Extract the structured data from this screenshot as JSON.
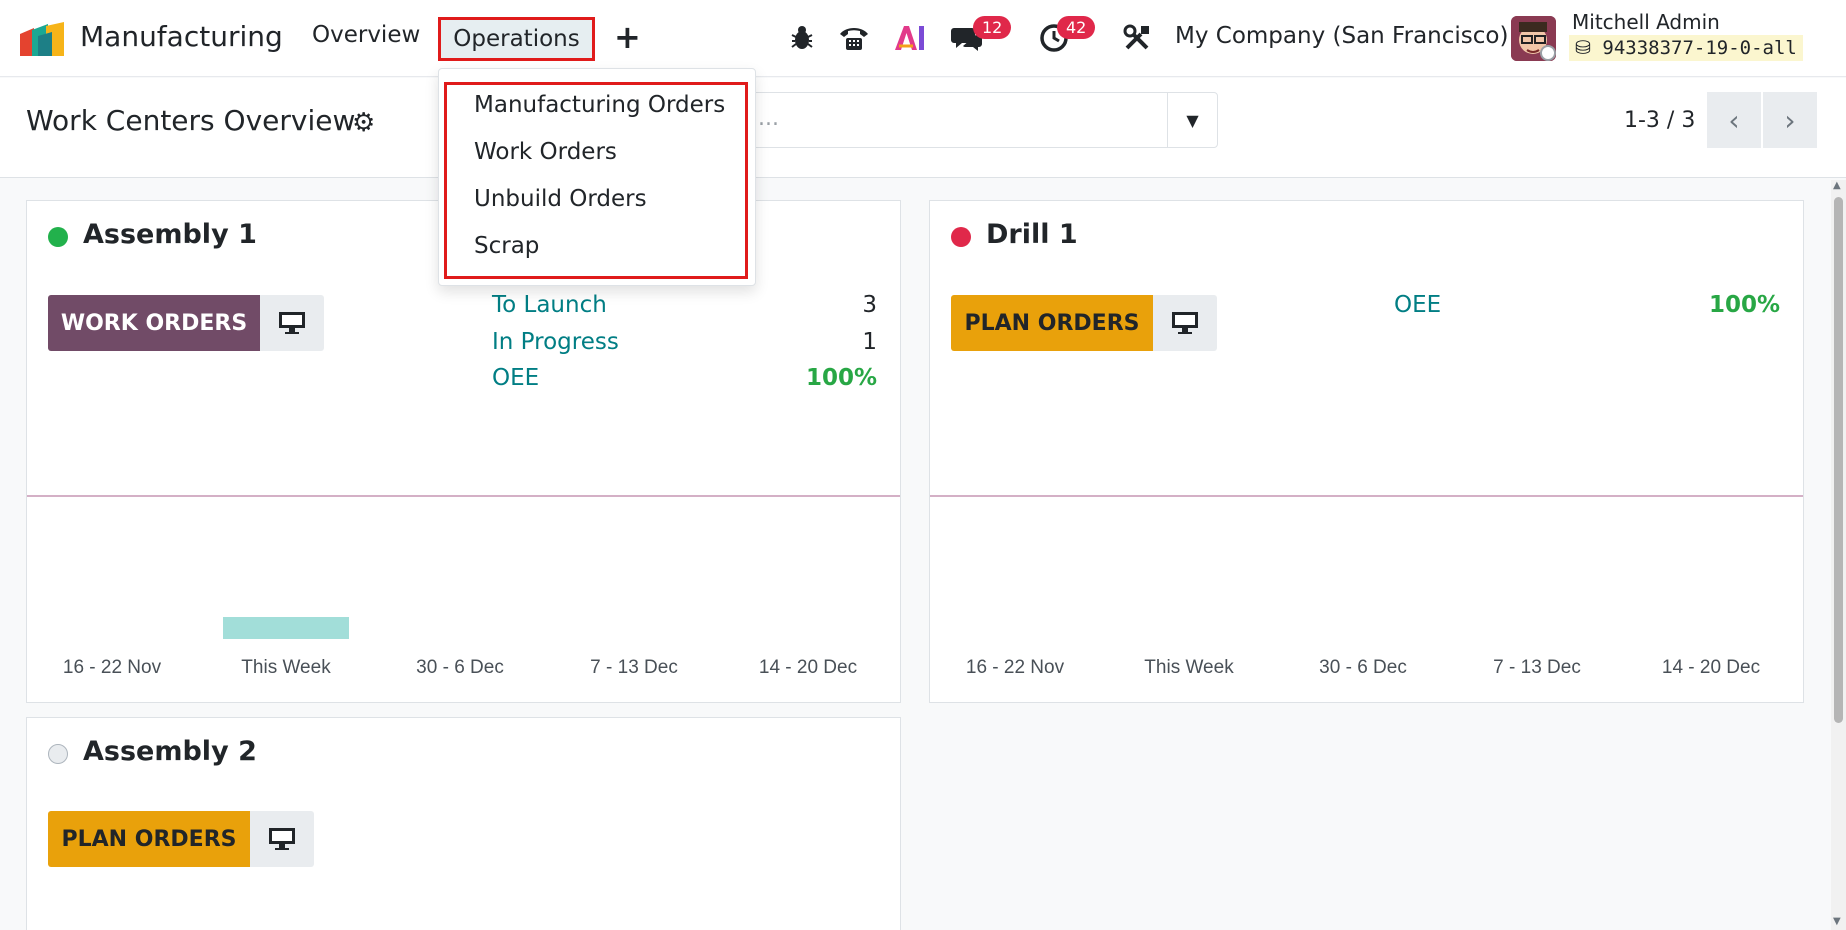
{
  "navbar": {
    "app_name": "Manufacturing",
    "menu": [
      "Overview",
      "Operations"
    ],
    "plus": "+",
    "chat_badge": "12",
    "activity_badge": "42",
    "company": "My Company (San Francisco)",
    "user_name": "Mitchell Admin",
    "database": "94338377-19-0-all"
  },
  "control": {
    "title": "Work Centers Overview",
    "search_placeholder": "...",
    "pager": "1-3 / 3"
  },
  "dropdown": {
    "items": [
      "Manufacturing Orders",
      "Work Orders",
      "Unbuild Orders",
      "Scrap"
    ]
  },
  "cards": [
    {
      "name": "Assembly 1",
      "status_color": "#22b14c",
      "button": "WORK ORDERS",
      "stats": [
        {
          "label": "To Launch",
          "value": "3"
        },
        {
          "label": "In Progress",
          "value": "1"
        },
        {
          "label": "OEE",
          "value": "100%"
        }
      ],
      "ticks": [
        "16 - 22 Nov",
        "This Week",
        "30 - 6 Dec",
        "7 - 13 Dec",
        "14 - 20 Dec"
      ]
    },
    {
      "name": "Drill 1",
      "status_color": "#e0284a",
      "button": "PLAN ORDERS",
      "stats": [
        {
          "label": "OEE",
          "value": "100%"
        }
      ],
      "ticks": [
        "16 - 22 Nov",
        "This Week",
        "30 - 6 Dec",
        "7 - 13 Dec",
        "14 - 20 Dec"
      ]
    },
    {
      "name": "Assembly 2",
      "status_color": "#e9ecef",
      "button": "PLAN ORDERS"
    }
  ],
  "chart_data": [
    {
      "type": "bar",
      "categories": [
        "16 - 22 Nov",
        "This Week",
        "30 - 6 Dec",
        "7 - 13 Dec",
        "14 - 20 Dec"
      ],
      "values": [
        0,
        1,
        0,
        0,
        0
      ]
    },
    {
      "type": "bar",
      "categories": [
        "16 - 22 Nov",
        "This Week",
        "30 - 6 Dec",
        "7 - 13 Dec",
        "14 - 20 Dec"
      ],
      "values": [
        0,
        0,
        0,
        0,
        0
      ]
    }
  ]
}
